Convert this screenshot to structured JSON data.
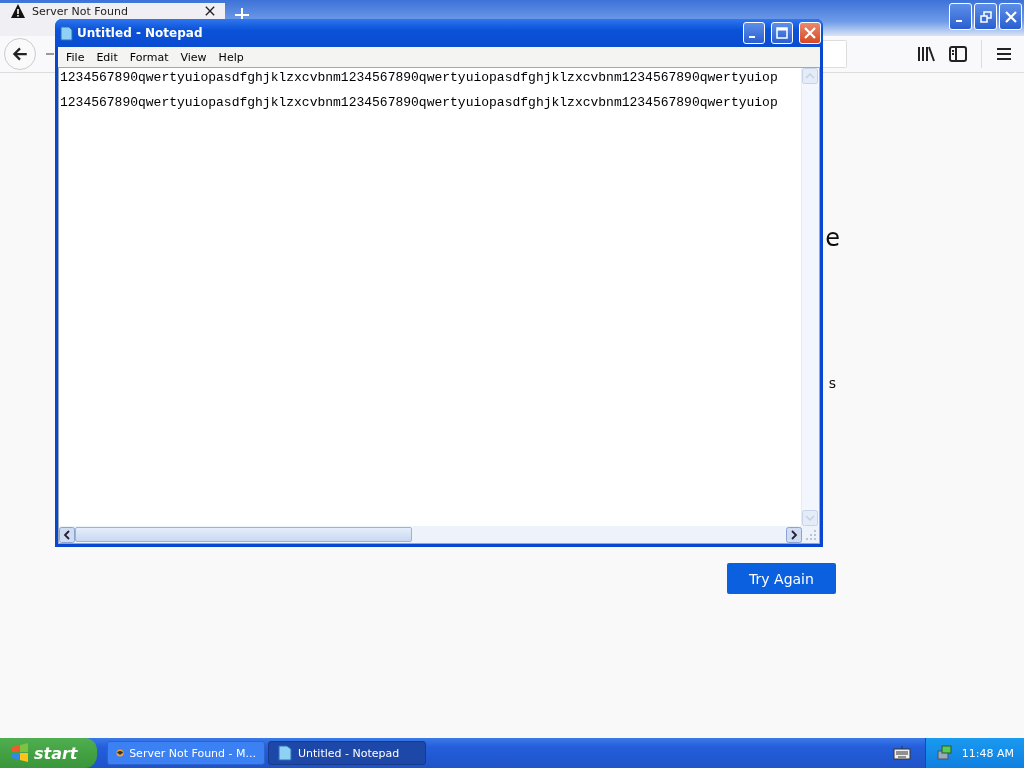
{
  "browser": {
    "tabs": [
      {
        "title": "Server Not Found",
        "selected": true
      }
    ]
  },
  "page": {
    "heading": "e",
    "text": "s",
    "button": "Try Again"
  },
  "notepad": {
    "title": "Untitled - Notepad",
    "menu": [
      "File",
      "Edit",
      "Format",
      "View",
      "Help"
    ],
    "lines": [
      "1234567890qwertyuiopasdfghjklzxcvbnm1234567890qwertyuiopasdfghjklzxcvbnm1234567890qwertyuiop",
      "1234567890qwertyuiopasdfghjklzxcvbnm1234567890qwertyuiopasdfghjklzxcvbnm1234567890qwertyuiop"
    ]
  },
  "taskbar": {
    "start": "start",
    "tasks": [
      {
        "label": "Server Not Found - M...",
        "kind": "browser",
        "selected": false
      },
      {
        "label": "Untitled - Notepad",
        "kind": "notepad",
        "selected": true
      }
    ],
    "clock": "11:48 AM"
  }
}
